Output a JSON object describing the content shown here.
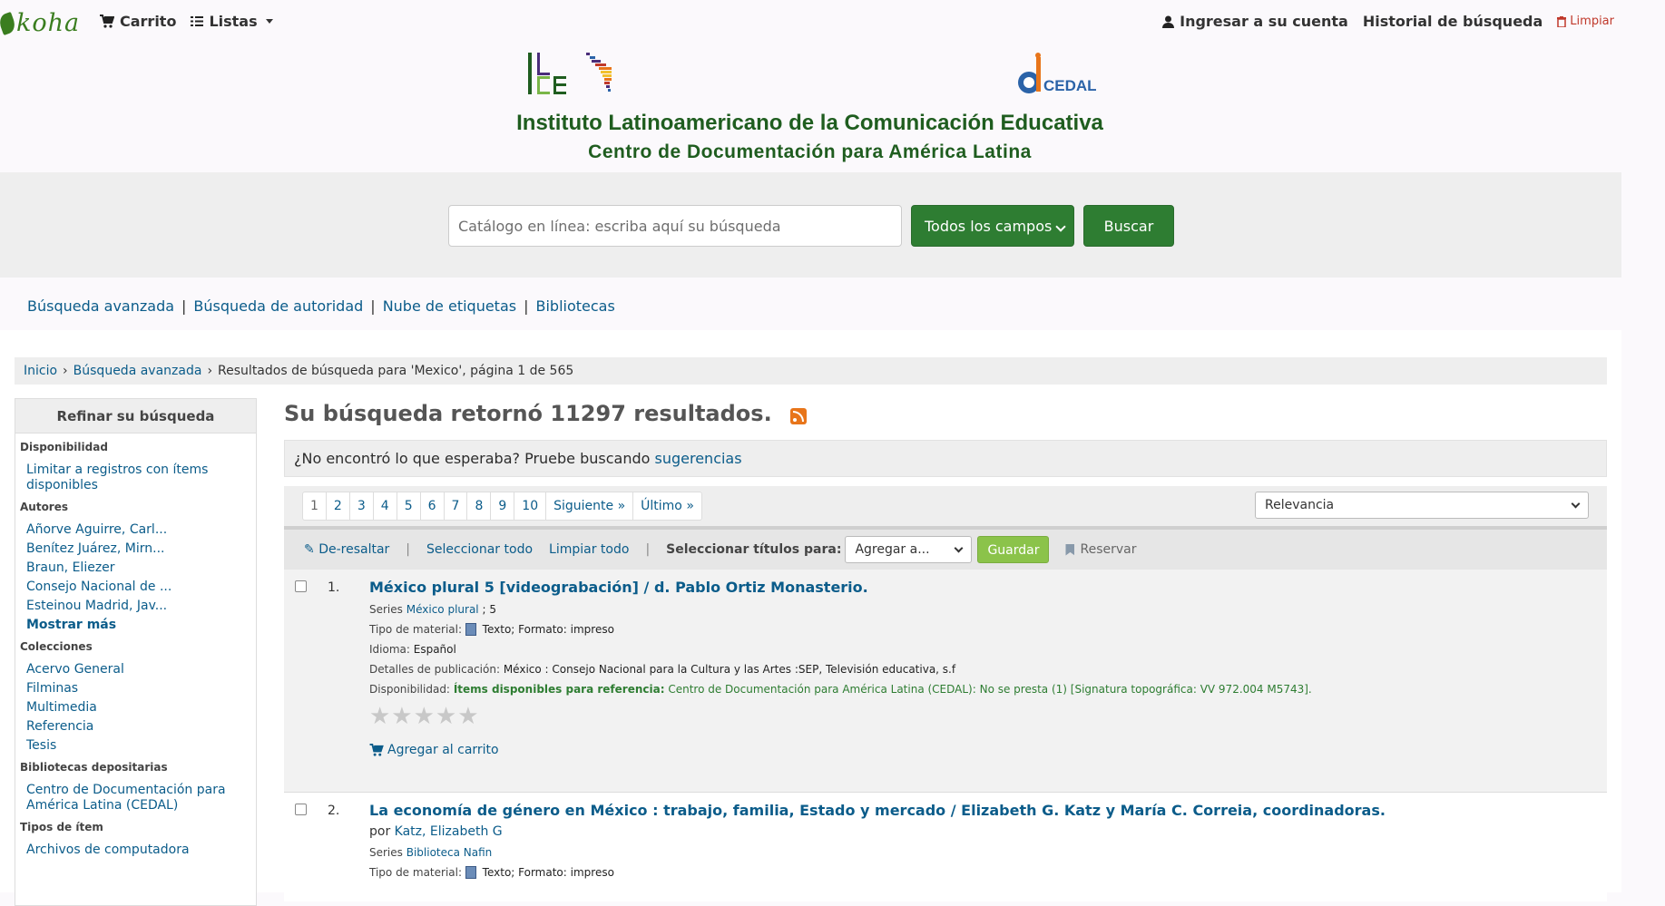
{
  "nav": {
    "logo": "koha",
    "cart": "Carrito",
    "lists": "Listas",
    "login": "Ingresar a su cuenta",
    "history": "Historial de búsqueda",
    "clear": "Limpiar"
  },
  "banner": {
    "title": "Instituto Latinoamericano de la Comunicación Educativa",
    "subtitle": "Centro de Documentación para América Latina",
    "cedal_logo_text": "CEDAL"
  },
  "search": {
    "placeholder": "Catálogo en línea: escriba aquí su búsqueda",
    "field": "Todos los campos",
    "button": "Buscar"
  },
  "moresearches": [
    "Búsqueda avanzada",
    "Búsqueda de autoridad",
    "Nube de etiquetas",
    "Bibliotecas"
  ],
  "breadcrumb": {
    "home": "Inicio",
    "advanced": "Búsqueda avanzada",
    "current": "Resultados de búsqueda para 'Mexico', página 1 de 565"
  },
  "facets": {
    "heading": "Refinar su búsqueda",
    "availability": {
      "title": "Disponibilidad",
      "items": [
        "Limitar a registros con ítems disponibles"
      ]
    },
    "authors": {
      "title": "Autores",
      "items": [
        "Añorve Aguirre, Carl...",
        "Benítez Juárez, Mirn...",
        "Braun, Eliezer",
        "Consejo Nacional de ...",
        "Esteinou Madrid, Jav..."
      ],
      "more": "Mostrar más"
    },
    "collections": {
      "title": "Colecciones",
      "items": [
        "Acervo General",
        "Filminas",
        "Multimedia",
        "Referencia",
        "Tesis"
      ]
    },
    "libraries": {
      "title": "Bibliotecas depositarias",
      "items": [
        "Centro de Documentación para América Latina (CEDAL)"
      ]
    },
    "itemtypes": {
      "title": "Tipos de ítem",
      "items": [
        "Archivos de computadora"
      ]
    }
  },
  "results": {
    "count_text": "Su búsqueda retornó 11297 resultados.",
    "suggest_text": "¿No encontró lo que esperaba? Pruebe buscando",
    "suggest_link": "sugerencias",
    "pages": [
      "1",
      "2",
      "3",
      "4",
      "5",
      "6",
      "7",
      "8",
      "9",
      "10"
    ],
    "next": "Siguiente »",
    "last": "Último »",
    "sort": "Relevancia"
  },
  "toolbar": {
    "unhighlight": "De-resaltar",
    "select_all": "Seleccionar todo",
    "clear_all": "Limpiar todo",
    "select_titles": "Seleccionar títulos para:",
    "add_to": "Agregar a...",
    "save": "Guardar",
    "reserve": "Reservar"
  },
  "records": [
    {
      "num": "1.",
      "title": "México plural 5 [videograbación] / d. Pablo Ortiz Monasterio.",
      "series_label": "Series",
      "series_value": "México plural",
      "series_num": "; 5",
      "material_label": "Tipo de material:",
      "material_value": "Texto; Formato: impreso",
      "language_label": "Idioma:",
      "language_value": "Español",
      "pub_label": "Detalles de publicación:",
      "pub_value": "México : Consejo Nacional para la Cultura y las Artes :SEP, Televisión educativa, s.f",
      "avail_label": "Disponibilidad:",
      "avail_strong": "Ítems disponibles para referencia:",
      "avail_value": "Centro de Documentación para América Latina (CEDAL): No se presta (1) [Signatura topográfica: VV 972.004 M5743].",
      "stars": "★★★★★",
      "cart": "Agregar al carrito"
    },
    {
      "num": "2.",
      "title": "La economía de género en México : trabajo, familia, Estado y mercado / Elizabeth G. Katz y María C. Correia, coordinadoras.",
      "by": "por",
      "author": "Katz, Elizabeth G",
      "series_label": "Series",
      "series_value": "Biblioteca Nafin",
      "material_label": "Tipo de material:",
      "material_value": "Texto; Formato: impreso"
    }
  ],
  "colors": {
    "accent_green": "#2e7d32",
    "link_blue": "#0b5c8a",
    "title_green": "#1f5d1f"
  }
}
